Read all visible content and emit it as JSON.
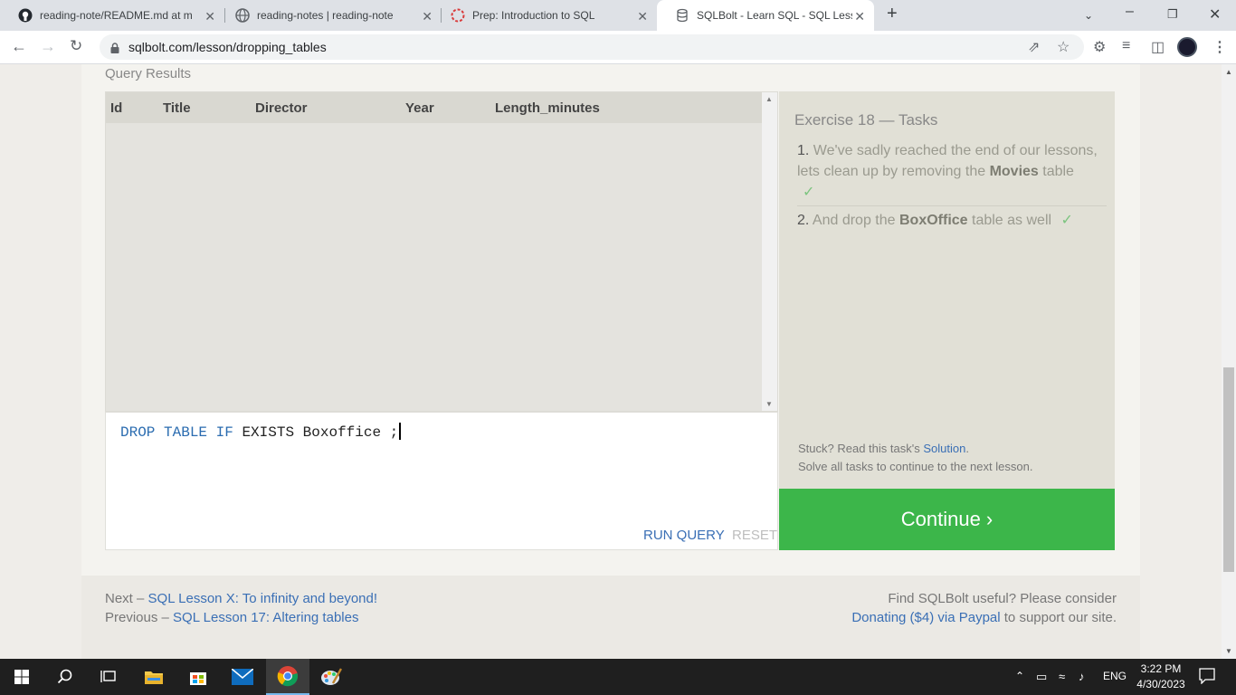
{
  "browser": {
    "tabs": [
      {
        "title": "reading-note/README.md at ma",
        "icon": "github-icon"
      },
      {
        "title": "reading-notes | reading-note",
        "icon": "globe-icon"
      },
      {
        "title": "Prep: Introduction to SQL",
        "icon": "codefellows-icon"
      },
      {
        "title": "SQLBolt - Learn SQL - SQL Lesson",
        "icon": "database-icon",
        "active": true
      }
    ],
    "close_glyph": "✕",
    "new_tab_glyph": "+",
    "url": "sqlbolt.com/lesson/dropping_tables"
  },
  "results": {
    "label": "Query Results",
    "columns": [
      "Id",
      "Title",
      "Director",
      "Year",
      "Length_minutes"
    ]
  },
  "editor": {
    "keywords": [
      "DROP",
      "TABLE",
      "IF"
    ],
    "text": "EXISTS Boxoffice ;",
    "run_label": "RUN QUERY",
    "reset_label": "RESET"
  },
  "tasks": {
    "title": "Exercise 18 — Tasks",
    "items": [
      {
        "num": "1.",
        "pre": "We've sadly reached the end of our lessons, lets clean up by removing the ",
        "bold": "Movies",
        "post": " table",
        "check": "✓"
      },
      {
        "num": "2.",
        "pre": "And drop the ",
        "bold": "BoxOffice",
        "post": " table as well",
        "check": "✓"
      }
    ],
    "stuck_pre": "Stuck? Read this task's ",
    "stuck_link": "Solution",
    "stuck_post": ".",
    "solve_all": "Solve all tasks to continue to the next lesson."
  },
  "continue_label": "Continue ›",
  "footer": {
    "next_prefix": "Next – ",
    "next_link": "SQL Lesson X: To infinity and beyond!",
    "prev_prefix": "Previous – ",
    "prev_link": "SQL Lesson 17: Altering tables",
    "find_text": "Find SQLBolt useful? Please consider",
    "donate_link": "Donating ($4) via Paypal",
    "donate_post": " to support our site."
  },
  "taskbar": {
    "lang": "ENG",
    "time": "3:22 PM",
    "date": "4/30/2023"
  },
  "colors": {
    "accent_green": "#3cb64a",
    "link_blue": "#3a6fb5"
  }
}
